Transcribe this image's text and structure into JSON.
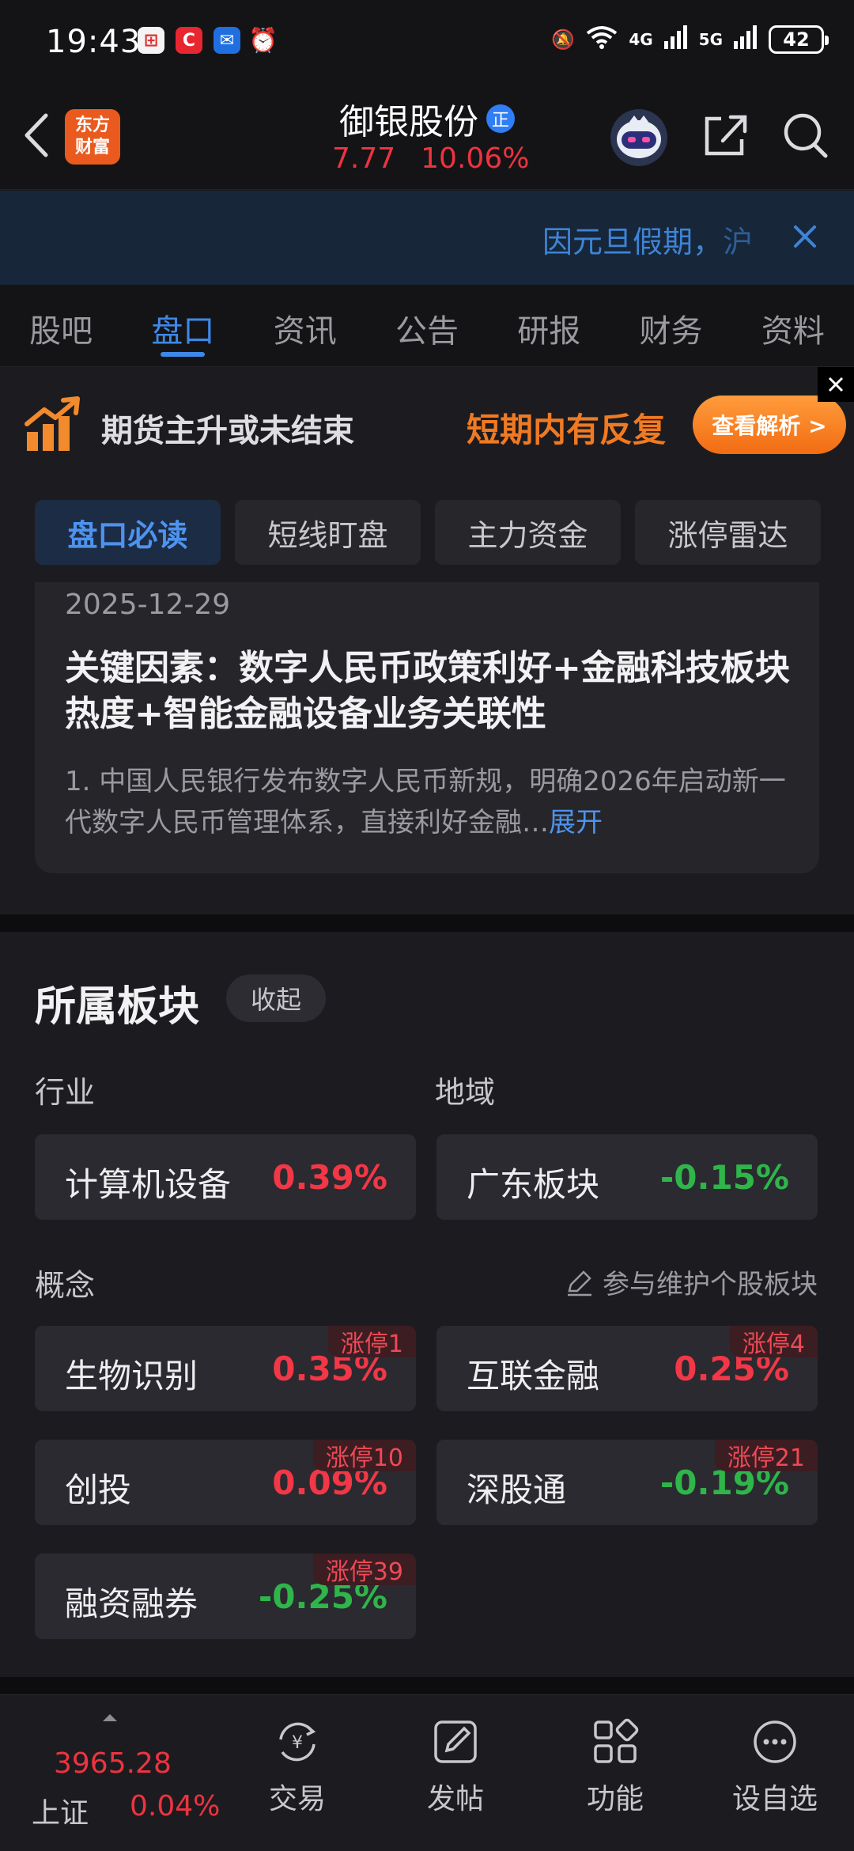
{
  "status_bar": {
    "time": "19:43",
    "network1": "4G",
    "network2": "5G",
    "battery": "42"
  },
  "header": {
    "logo_line1": "东方",
    "logo_line2": "财富",
    "stock_name": "御银股份",
    "stock_badge": "正",
    "price": "7.77",
    "change_pct": "10.06%"
  },
  "notice": {
    "text_main": "因元旦假期，",
    "text_fade": "沪"
  },
  "tabs": [
    {
      "label": "股吧"
    },
    {
      "label": "盘口"
    },
    {
      "label": "资讯"
    },
    {
      "label": "公告"
    },
    {
      "label": "研报"
    },
    {
      "label": "财务"
    },
    {
      "label": "资料"
    }
  ],
  "banner": {
    "left_text": "期货主升或未结束",
    "right_text": "短期内有反复",
    "button": "查看解析 >"
  },
  "subtabs": [
    {
      "label": "盘口必读"
    },
    {
      "label": "短线盯盘"
    },
    {
      "label": "主力资金"
    },
    {
      "label": "涨停雷达"
    }
  ],
  "card": {
    "date": "2025-12-29",
    "title": "关键因素：数字人民币政策利好+金融科技板块热度+智能金融设备业务关联性",
    "body": "1. 中国人民银行发布数字人民币新规，明确2026年启动新一代数字人民币管理体系，直接利好金融…",
    "expand": "展开"
  },
  "sector": {
    "title": "所属板块",
    "collapse": "收起",
    "industry_label": "行业",
    "region_label": "地域",
    "concept_label": "概念",
    "maintain": "参与维护个股板块",
    "industry": {
      "name": "计算机设备",
      "value": "0.39%"
    },
    "region": {
      "name": "广东板块",
      "value": "-0.15%"
    },
    "concepts": [
      {
        "name": "生物识别",
        "value": "0.35%",
        "tag": "涨停1"
      },
      {
        "name": "互联金融",
        "value": "0.25%",
        "tag": "涨停4"
      },
      {
        "name": "创投",
        "value": "0.09%",
        "tag": "涨停10"
      },
      {
        "name": "深股通",
        "value": "-0.19%",
        "tag": "涨停21"
      },
      {
        "name": "融资融券",
        "value": "-0.25%",
        "tag": "涨停39"
      }
    ]
  },
  "bottom": {
    "index_value": "3965.28",
    "index_name": "上证",
    "index_pct": "0.04%",
    "nav": [
      {
        "label": "交易"
      },
      {
        "label": "发帖"
      },
      {
        "label": "功能"
      },
      {
        "label": "设自选"
      }
    ]
  },
  "colors": {
    "up": "#f23746",
    "down": "#2fb54a",
    "accent": "#3e88e8",
    "brand": "#ea5a1e"
  }
}
